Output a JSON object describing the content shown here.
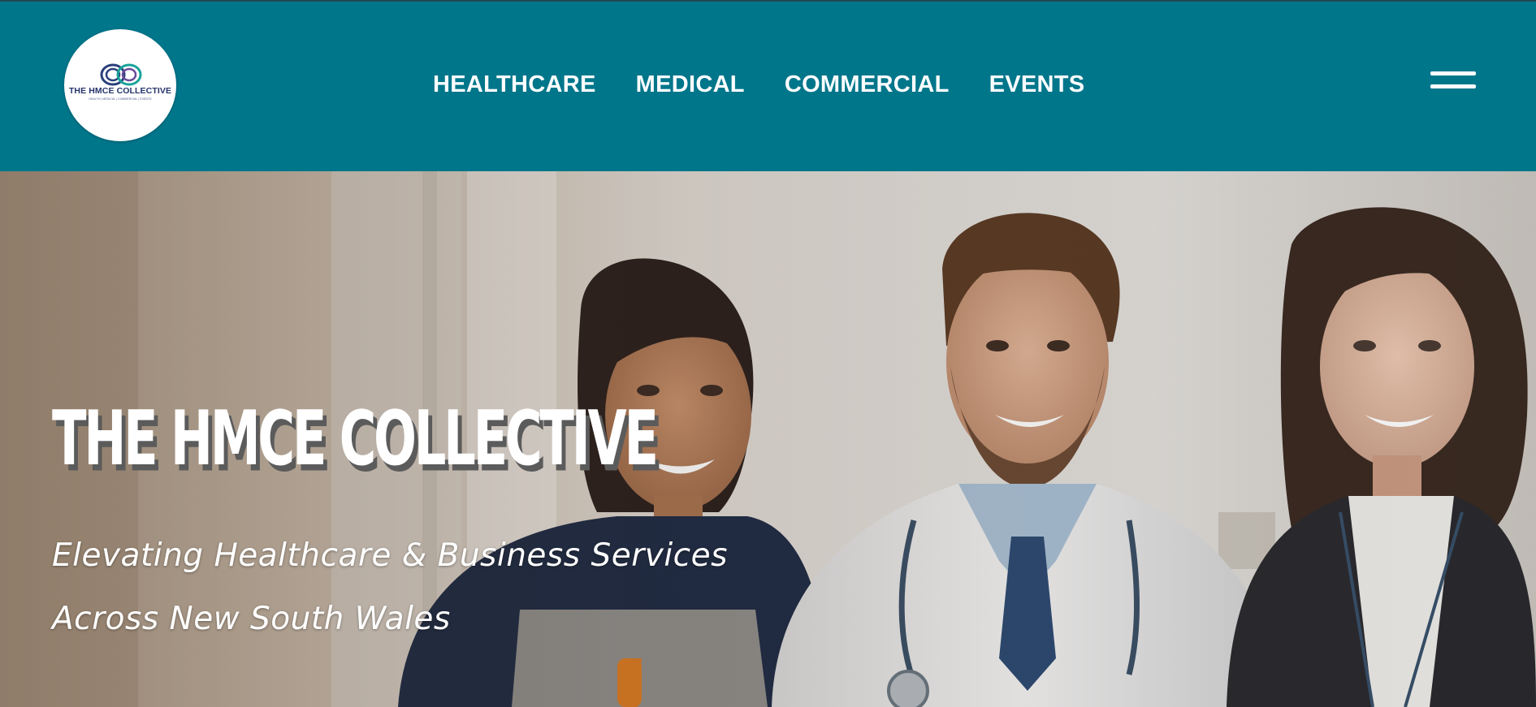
{
  "brand": {
    "name": "THE HMCE COLLECTIVE",
    "tagline": "HEALTH | MEDICAL | COMMERCIAL | EVENTS"
  },
  "nav": {
    "items": [
      {
        "label": "HEALTHCARE"
      },
      {
        "label": "MEDICAL"
      },
      {
        "label": "COMMERCIAL"
      },
      {
        "label": "EVENTS"
      }
    ],
    "menu_icon": "hamburger-menu-icon"
  },
  "hero": {
    "title": "THE HMCE COLLECTIVE",
    "subtitle_line_1": "Elevating Healthcare & Business Services",
    "subtitle_line_2": "Across New South Wales",
    "image_description": "three smiling professionals: cleaner, doctor and businesswoman"
  },
  "colors": {
    "header_bg": "#00768b",
    "nav_text": "#ffffff",
    "logo_text": "#25346b",
    "logo_ring_1": "#2a3f7a",
    "logo_ring_2": "#6a4a9a",
    "logo_ring_3": "#1aa39a",
    "hero_text": "#ffffff"
  }
}
